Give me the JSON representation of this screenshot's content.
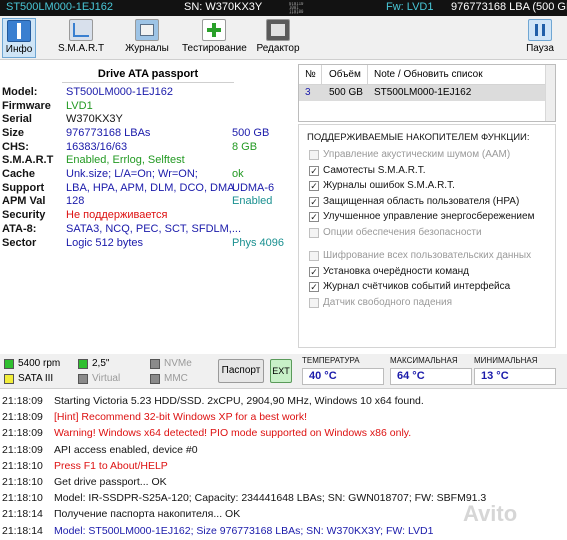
{
  "topbar": {
    "model": "ST500LM000-1EJ162",
    "sn": "SN: W370KX3Y",
    "fw": "Fw: LVD1",
    "lba": "976773168 LBA (500 GB)"
  },
  "toolbar": {
    "info": "Инфо",
    "smart": "S.M.A.R.T",
    "logs": "Журналы",
    "test": "Тестирование",
    "editor": "Редактор",
    "pause": "Пауза"
  },
  "passport": {
    "title": "Drive ATA passport",
    "rows": [
      {
        "key": "Model:",
        "value": "ST500LM000-1EJ162",
        "extra": ""
      },
      {
        "key": "Firmware",
        "value": "LVD1",
        "extra": ""
      },
      {
        "key": "Serial",
        "value": "W370KX3Y",
        "extra": ""
      },
      {
        "key": "Size",
        "value": "976773168 LBAs",
        "extra": "500 GB"
      },
      {
        "key": "CHS:",
        "value": "16383/16/63",
        "extra": "8 GB"
      },
      {
        "key": "S.M.A.R.T",
        "value": "Enabled, Errlog, Selftest",
        "extra": ""
      },
      {
        "key": "Cache",
        "value": "Unk.size; L/A=On; Wr=ON;",
        "extra": "ok"
      },
      {
        "key": "Support",
        "value": "LBA, HPA, APM, DLM, DCO, DMA",
        "extra": "UDMA-6"
      },
      {
        "key": "APM Val",
        "value": "128",
        "extra": "Enabled"
      },
      {
        "key": "Security",
        "value": "Не поддерживается",
        "extra": ""
      },
      {
        "key": "ATA-8:",
        "value": "SATA3, NCQ, PEC, SCT, SFDLM,...",
        "extra": ""
      },
      {
        "key": "Sector",
        "value": "Logic 512 bytes",
        "extra": "Phys 4096"
      }
    ]
  },
  "drives": {
    "headers": [
      "№",
      "Объём",
      "Note / Обновить список"
    ],
    "rows": [
      {
        "num": "3",
        "size": "500 GB",
        "note": "ST500LM000-1EJ162"
      }
    ]
  },
  "features": {
    "title": "ПОДДЕРЖИВАЕМЫЕ НАКОПИТЕЛЕМ ФУНКЦИИ:",
    "items": [
      {
        "label": "Управление акустическим шумом (AAM)",
        "checked": false
      },
      {
        "label": "Самотесты S.M.A.R.T.",
        "checked": true
      },
      {
        "label": "Журналы ошибок S.M.A.R.T.",
        "checked": true
      },
      {
        "label": "Защищенная область пользователя (HPA)",
        "checked": true
      },
      {
        "label": "Улучшенное управление энергосбережением",
        "checked": true
      },
      {
        "label": "Опции обеспечения безопасности",
        "checked": false
      },
      {
        "label": "Шифрование всех пользовательских данных",
        "checked": false
      },
      {
        "label": "Установка очерёдности команд",
        "checked": true
      },
      {
        "label": "Журнал счётчиков событий интерфейса",
        "checked": true
      },
      {
        "label": "Датчик свободного падения",
        "checked": false
      }
    ]
  },
  "legend": {
    "rpm": "5400 rpm",
    "form": "2,5\"",
    "nvme": "NVMe",
    "sata": "SATA III",
    "virtual": "Virtual",
    "mmc": "MMC",
    "colors": {
      "rpm": "#2fbf2f",
      "form": "#2fbf2f",
      "nvme": "#8a8a8a",
      "sata": "#f2ee3a",
      "virtual": "#8a8a8a",
      "mmc": "#8a8a8a"
    }
  },
  "buttons": {
    "passport": "Паспорт",
    "ext": "EXT"
  },
  "temps": {
    "current_label": "ТЕМПЕРАТУРА",
    "current": "40 °C",
    "max_label": "МАКСИМАЛЬНАЯ",
    "max": "64 °C",
    "min_label": "МИНИМАЛЬНАЯ",
    "min": "13 °C"
  },
  "log": [
    {
      "time": "21:18:09",
      "msg": "Starting Victoria 5.23 HDD/SSD. 2xCPU, 2904,90 MHz, Windows 10 x64 found.",
      "color": "dark"
    },
    {
      "time": "21:18:09",
      "msg": "[Hint] Recommend 32-bit Windows XP for a best work!",
      "color": "red"
    },
    {
      "time": "21:18:09",
      "msg": "Warning! Windows x64 detected! PIO mode supported on Windows x86 only.",
      "color": "red"
    },
    {
      "time": "21:18:09",
      "msg": "API access enabled, device #0",
      "color": "dark"
    },
    {
      "time": "21:18:10",
      "msg": "Press F1 to About/HELP",
      "color": "red"
    },
    {
      "time": "21:18:10",
      "msg": "Get drive passport... OK",
      "color": "dark"
    },
    {
      "time": "21:18:10",
      "msg": "Model: IR-SSDPR-S25A-120; Capacity: 234441648 LBAs; SN: GWN018707; FW: SBFM91.3",
      "color": "dark"
    },
    {
      "time": "21:18:14",
      "msg": "Получение паспорта накопителя... OK",
      "color": "dark"
    },
    {
      "time": "21:18:14",
      "msg": "Model: ST500LM000-1EJ162; Size 976773168 LBAs; SN: W370KX3Y; FW: LVD1",
      "color": "blue"
    }
  ],
  "watermark": "Avito"
}
